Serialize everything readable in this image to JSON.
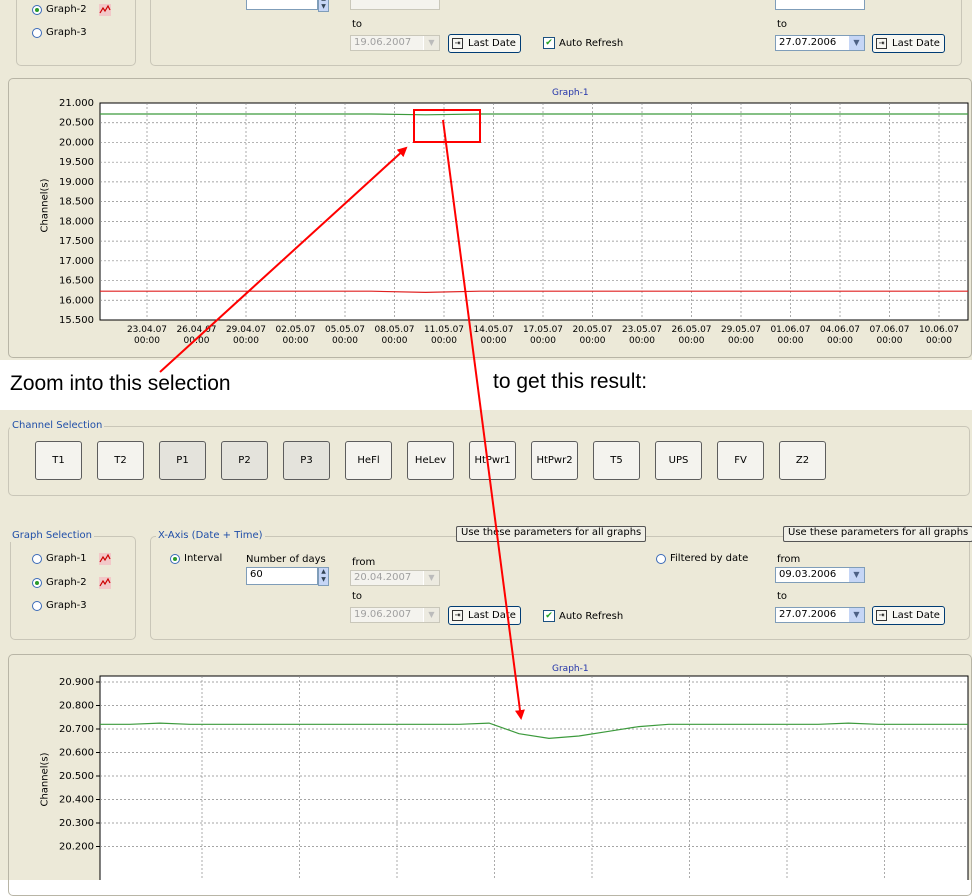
{
  "top": {
    "graph_selection": {
      "items": [
        {
          "label": "Graph-2",
          "selected": true
        },
        {
          "label": "Graph-3",
          "selected": false
        }
      ]
    },
    "xaxis": {
      "to_label": "to",
      "to_value": "19.06.2007",
      "last_date": "Last Date",
      "auto_refresh": "Auto Refresh",
      "filtered_to_label": "to",
      "filtered_to_value": "27.07.2006",
      "filtered_last_date": "Last Date"
    },
    "graph": {
      "title": "Graph-1",
      "ylabel": "Channel(s)",
      "yticks": [
        "21.000",
        "20.500",
        "20.000",
        "19.500",
        "19.000",
        "18.500",
        "18.000",
        "17.500",
        "17.000",
        "16.500",
        "16.000",
        "15.500"
      ],
      "xticks": [
        [
          "23.04.07",
          "00:00"
        ],
        [
          "26.04.07",
          "00:00"
        ],
        [
          "29.04.07",
          "00:00"
        ],
        [
          "02.05.07",
          "00:00"
        ],
        [
          "05.05.07",
          "00:00"
        ],
        [
          "08.05.07",
          "00:00"
        ],
        [
          "11.05.07",
          "00:00"
        ],
        [
          "14.05.07",
          "00:00"
        ],
        [
          "17.05.07",
          "00:00"
        ],
        [
          "20.05.07",
          "00:00"
        ],
        [
          "23.05.07",
          "00:00"
        ],
        [
          "26.05.07",
          "00:00"
        ],
        [
          "29.05.07",
          "00:00"
        ],
        [
          "01.06.07",
          "00:00"
        ],
        [
          "04.06.07",
          "00:00"
        ],
        [
          "07.06.07",
          "00:00"
        ],
        [
          "10.06.07",
          "00:00"
        ]
      ]
    }
  },
  "captions": {
    "left": "Zoom into this selection",
    "right": "to get this result:"
  },
  "bottom": {
    "channel_selection": {
      "legend": "Channel Selection",
      "channels": [
        "T1",
        "T2",
        "P1",
        "P2",
        "P3",
        "HeFl",
        "HeLev",
        "HtPwr1",
        "HtPwr2",
        "T5",
        "UPS",
        "FV",
        "Z2"
      ],
      "pressed": [
        "P1",
        "P2",
        "P3"
      ]
    },
    "graph_selection": {
      "legend": "Graph Selection",
      "items": [
        {
          "label": "Graph-1",
          "selected": false
        },
        {
          "label": "Graph-2",
          "selected": true
        },
        {
          "label": "Graph-3",
          "selected": false
        }
      ]
    },
    "xaxis": {
      "legend": "X-Axis (Date + Time)",
      "use_params_1": "Use these parameters for all graphs",
      "use_params_2": "Use these parameters for all graphs",
      "interval_label": "Interval",
      "number_of_days_label": "Number of days",
      "number_of_days_value": "60",
      "from_label": "from",
      "from_value": "20.04.2007",
      "to_label": "to",
      "to_value": "19.06.2007",
      "last_date": "Last Date",
      "auto_refresh": "Auto Refresh",
      "filtered_label": "Filtered by date",
      "filtered_from_label": "from",
      "filtered_from_value": "09.03.2006",
      "filtered_to_label": "to",
      "filtered_to_value": "27.07.2006",
      "filtered_last_date": "Last Date"
    },
    "graph": {
      "title": "Graph-1",
      "ylabel": "Channel(s)",
      "yticks": [
        "20.900",
        "20.800",
        "20.700",
        "20.600",
        "20.500",
        "20.400",
        "20.300",
        "20.200"
      ]
    }
  },
  "chart_data": [
    {
      "type": "line",
      "title": "Graph-1",
      "ylabel": "Channel(s)",
      "ylim": [
        15.5,
        21.0
      ],
      "categories": [
        "23.04.07 00:00",
        "26.04.07 00:00",
        "29.04.07 00:00",
        "02.05.07 00:00",
        "05.05.07 00:00",
        "08.05.07 00:00",
        "11.05.07 00:00",
        "14.05.07 00:00",
        "17.05.07 00:00",
        "20.05.07 00:00",
        "23.05.07 00:00",
        "26.05.07 00:00",
        "29.05.07 00:00",
        "01.06.07 00:00",
        "04.06.07 00:00",
        "07.06.07 00:00",
        "10.06.07 00:00"
      ],
      "series": [
        {
          "color": "#3c9a3c",
          "values": [
            20.72,
            20.72,
            20.72,
            20.72,
            20.72,
            20.72,
            20.7,
            20.72,
            20.72,
            20.72,
            20.72,
            20.72,
            20.72,
            20.72,
            20.72,
            20.72,
            20.72
          ]
        },
        {
          "color": "#e02020",
          "values": [
            16.23,
            16.23,
            16.23,
            16.23,
            16.23,
            16.23,
            16.2,
            16.23,
            16.23,
            16.23,
            16.23,
            16.23,
            16.23,
            16.23,
            16.23,
            16.23,
            16.23
          ]
        }
      ],
      "grid": true,
      "annotation": "red rectangle selection around 11.05.07 at ~20.7"
    },
    {
      "type": "line",
      "title": "Graph-1",
      "ylabel": "Channel(s)",
      "ylim": [
        20.2,
        20.9
      ],
      "series": [
        {
          "color": "#3c9a3c",
          "values": [
            20.72,
            20.72,
            20.725,
            20.72,
            20.72,
            20.72,
            20.72,
            20.72,
            20.72,
            20.72,
            20.72,
            20.72,
            20.72,
            20.725,
            20.68,
            20.66,
            20.67,
            20.69,
            20.71,
            20.72,
            20.72,
            20.72,
            20.72,
            20.72,
            20.72,
            20.725,
            20.72,
            20.72,
            20.72,
            20.72
          ]
        }
      ],
      "grid": true
    }
  ]
}
